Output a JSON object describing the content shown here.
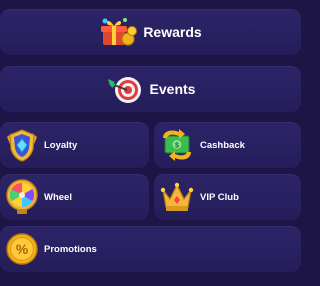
{
  "menu": {
    "rewards": {
      "label": "Rewards",
      "icon": "gift-coins-icon"
    },
    "events": {
      "label": "Events",
      "icon": "dart-target-icon"
    },
    "loyalty": {
      "label": "Loyalty",
      "icon": "shield-gem-icon"
    },
    "cashback": {
      "label": "Cashback",
      "icon": "cash-arrow-icon"
    },
    "wheel": {
      "label": "Wheel",
      "icon": "fortune-wheel-icon"
    },
    "vip": {
      "label": "VIP Club",
      "icon": "crown-icon"
    },
    "promotions": {
      "label": "Promotions",
      "icon": "percent-coin-icon"
    }
  },
  "colors": {
    "background": "#1c1545",
    "tile": "#2a2262",
    "text": "#ffffff"
  }
}
